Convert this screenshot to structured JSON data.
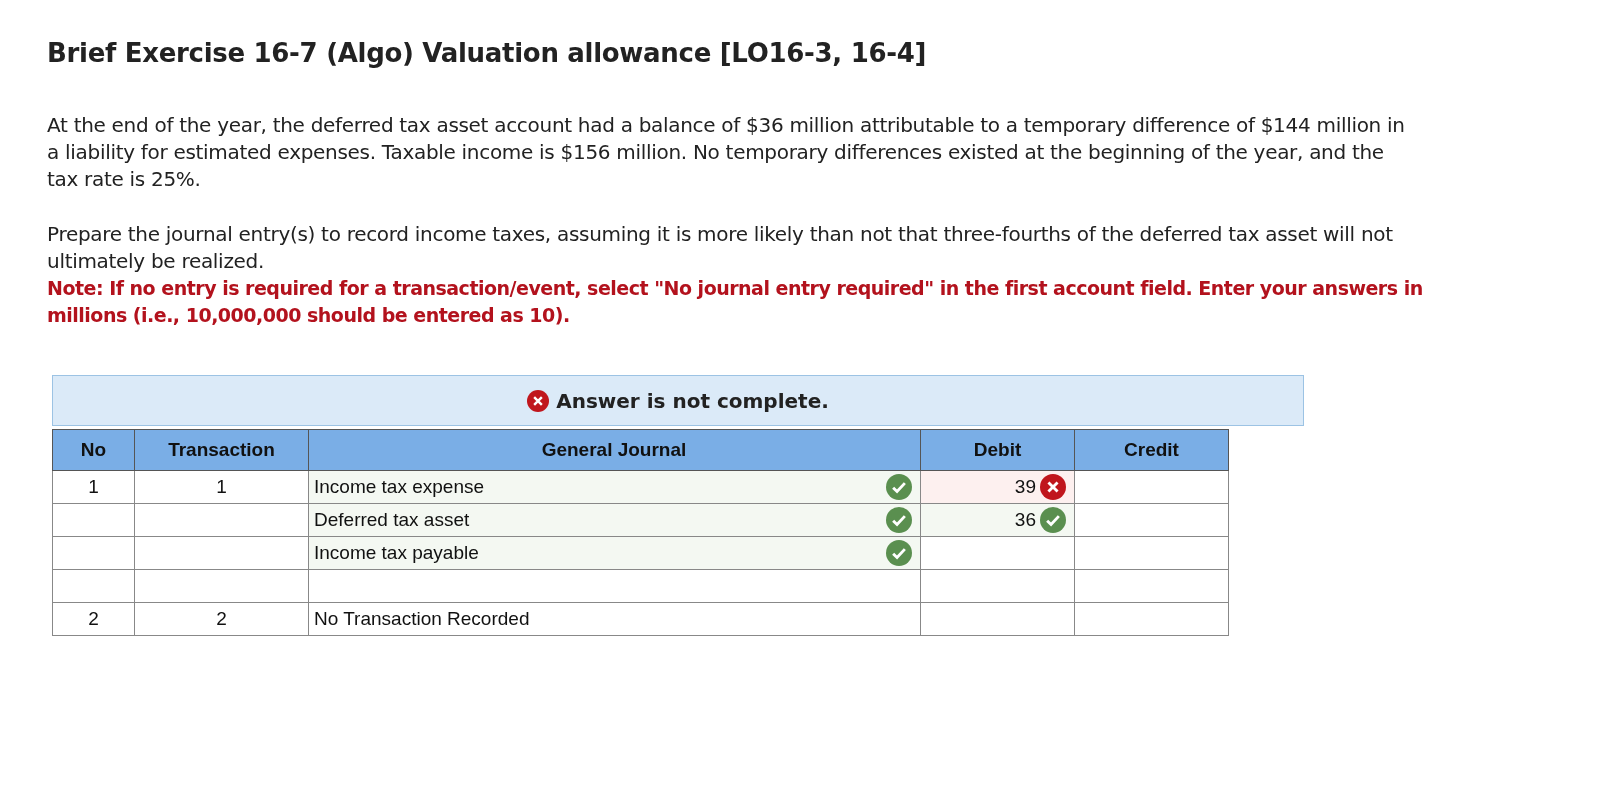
{
  "title": "Brief Exercise 16-7 (Algo) Valuation allowance [LO16-3, 16-4]",
  "paragraphs": [
    "At the end of the year, the deferred tax asset account had a balance of $36 million attributable to a temporary difference of $144 million in a liability for estimated expenses. Taxable income is $156 million. No temporary differences existed at the beginning of the year, and the tax rate is 25%.",
    "Prepare the journal entry(s) to record income taxes, assuming it is more likely than not that three-fourths of the deferred tax asset will not ultimately be realized."
  ],
  "note": "Note: If no entry is required for a transaction/event, select \"No journal entry required\" in the first account field. Enter your answers in millions (i.e., 10,000,000 should be entered as 10).",
  "banner": {
    "complete": false,
    "text": "Answer is not complete."
  },
  "table": {
    "columns": [
      "No",
      "Transaction",
      "General Journal",
      "Debit",
      "Credit"
    ],
    "rows": [
      {
        "no": "1",
        "transaction": "1",
        "account": "Income tax expense",
        "account_correct": true,
        "debit": "39",
        "debit_correct": false
      },
      {
        "account": "Deferred tax asset",
        "account_correct": true,
        "debit": "36",
        "debit_correct": true
      },
      {
        "account": "Income tax payable",
        "account_correct": true
      },
      {},
      {
        "no": "2",
        "transaction": "2",
        "account": "No Transaction Recorded"
      }
    ]
  }
}
